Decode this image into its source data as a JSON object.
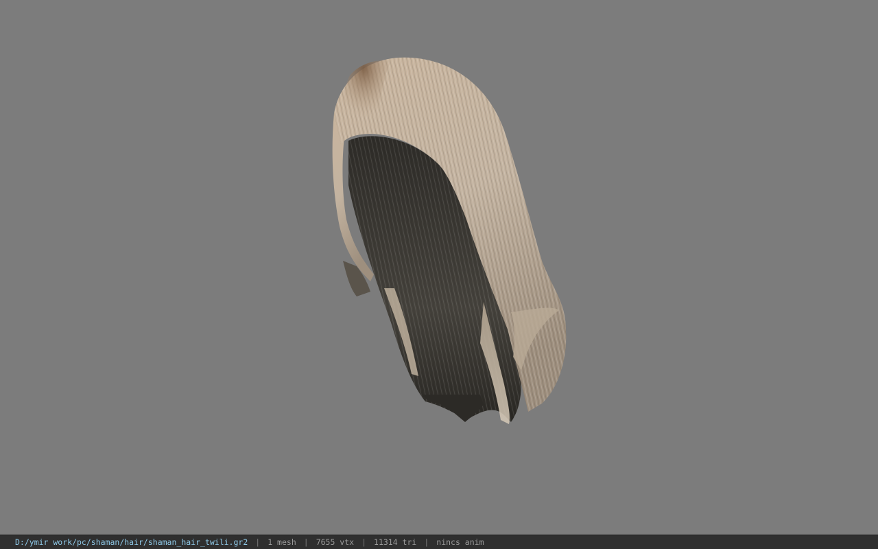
{
  "status_bar": {
    "file_path": "D:/ymir work/pc/shaman/hair/shaman_hair_twili.gr2",
    "separator": "|",
    "mesh_count": "1 mesh",
    "vertex_count": "7655 vtx",
    "triangle_count": "11314 tri",
    "animation": "nincs anim"
  },
  "colors": {
    "viewport_bg": "#7c7c7c",
    "statusbar_bg": "#2f2f2f",
    "path_text": "#8fc9e8",
    "info_text": "#9a9a9a",
    "hair_light": "#c8b7a2",
    "hair_dark": "#3d3a34",
    "hair_root": "#8a6f55"
  }
}
